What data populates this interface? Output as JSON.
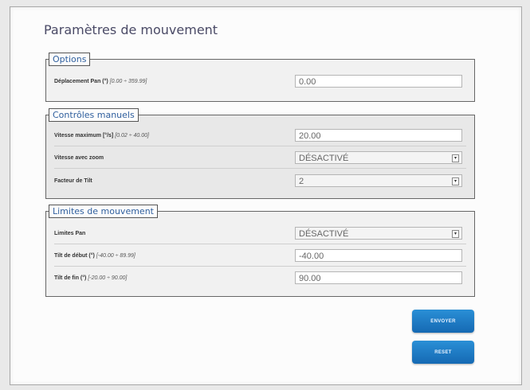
{
  "page": {
    "title": "Paramètres de mouvement"
  },
  "options": {
    "legend": "Options",
    "pan_label": "Déplacement Pan (°)",
    "pan_range": "[0.00 ÷ 359.99]",
    "pan_value": "0.00"
  },
  "manual": {
    "legend": "Contrôles manuels",
    "max_speed_label": "Vitesse maximum [°/s]",
    "max_speed_range": "[0.02 ÷ 40.00]",
    "max_speed_value": "20.00",
    "zoom_speed_label": "Vitesse avec zoom",
    "zoom_speed_value": "DÉSACTIVÉ",
    "tilt_factor_label": "Facteur de Tilt",
    "tilt_factor_value": "2"
  },
  "limits": {
    "legend": "Limites de mouvement",
    "pan_limits_label": "Limites Pan",
    "pan_limits_value": "DÉSACTIVÉ",
    "tilt_start_label": "Tilt de début (°)",
    "tilt_start_range": "[-40.00 ÷ 89.99]",
    "tilt_start_value": "-40.00",
    "tilt_end_label": "Tilt de fin (°)",
    "tilt_end_range": "[-20.00 ÷ 90.00]",
    "tilt_end_value": "90.00"
  },
  "buttons": {
    "send": "ENVOYER",
    "reset": "RESET"
  }
}
